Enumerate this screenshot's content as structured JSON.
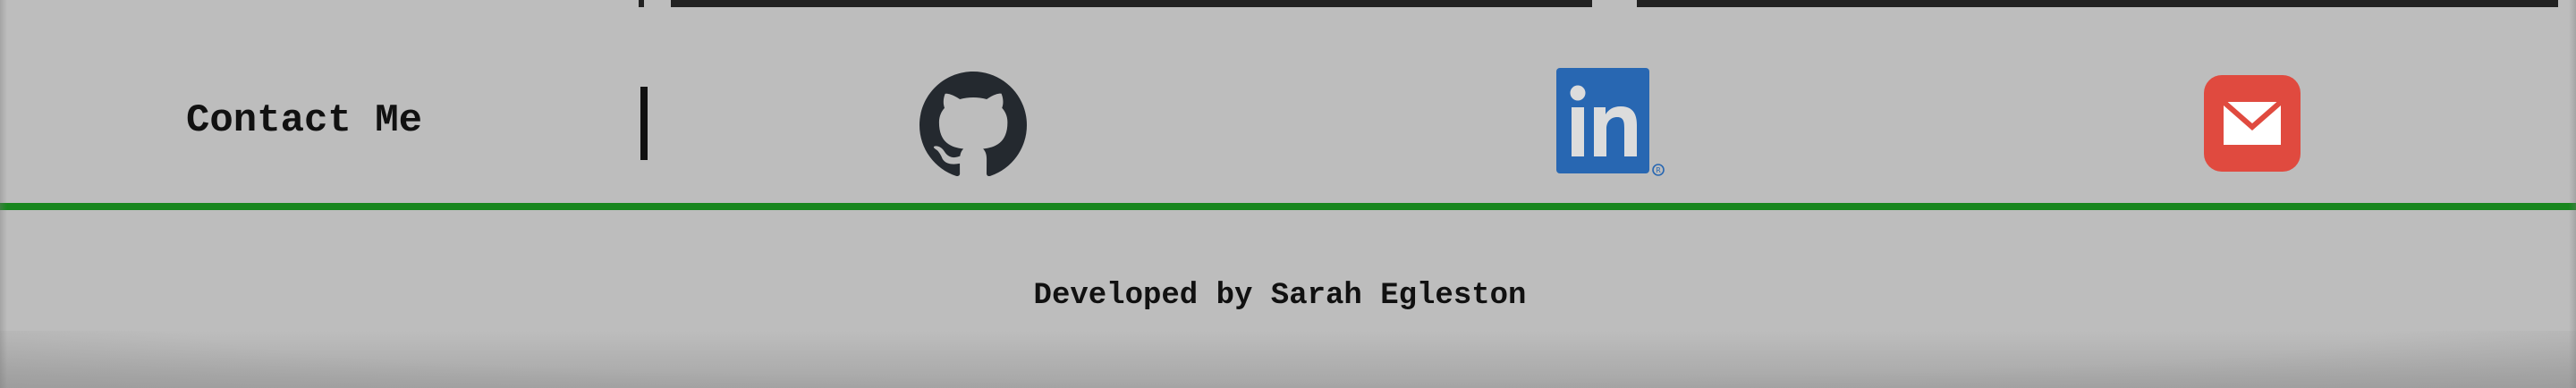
{
  "contact": {
    "title": "Contact Me",
    "links": {
      "github": {
        "icon": "github-icon",
        "color": "#24292f"
      },
      "linkedin": {
        "icon": "linkedin-icon",
        "color": "#2867b2",
        "logo_text": "in"
      },
      "email": {
        "icon": "email-icon",
        "color": "#e04a3f"
      }
    }
  },
  "separator": {
    "color": "#18861e"
  },
  "footer": {
    "credit": "Developed by Sarah Egleston"
  }
}
